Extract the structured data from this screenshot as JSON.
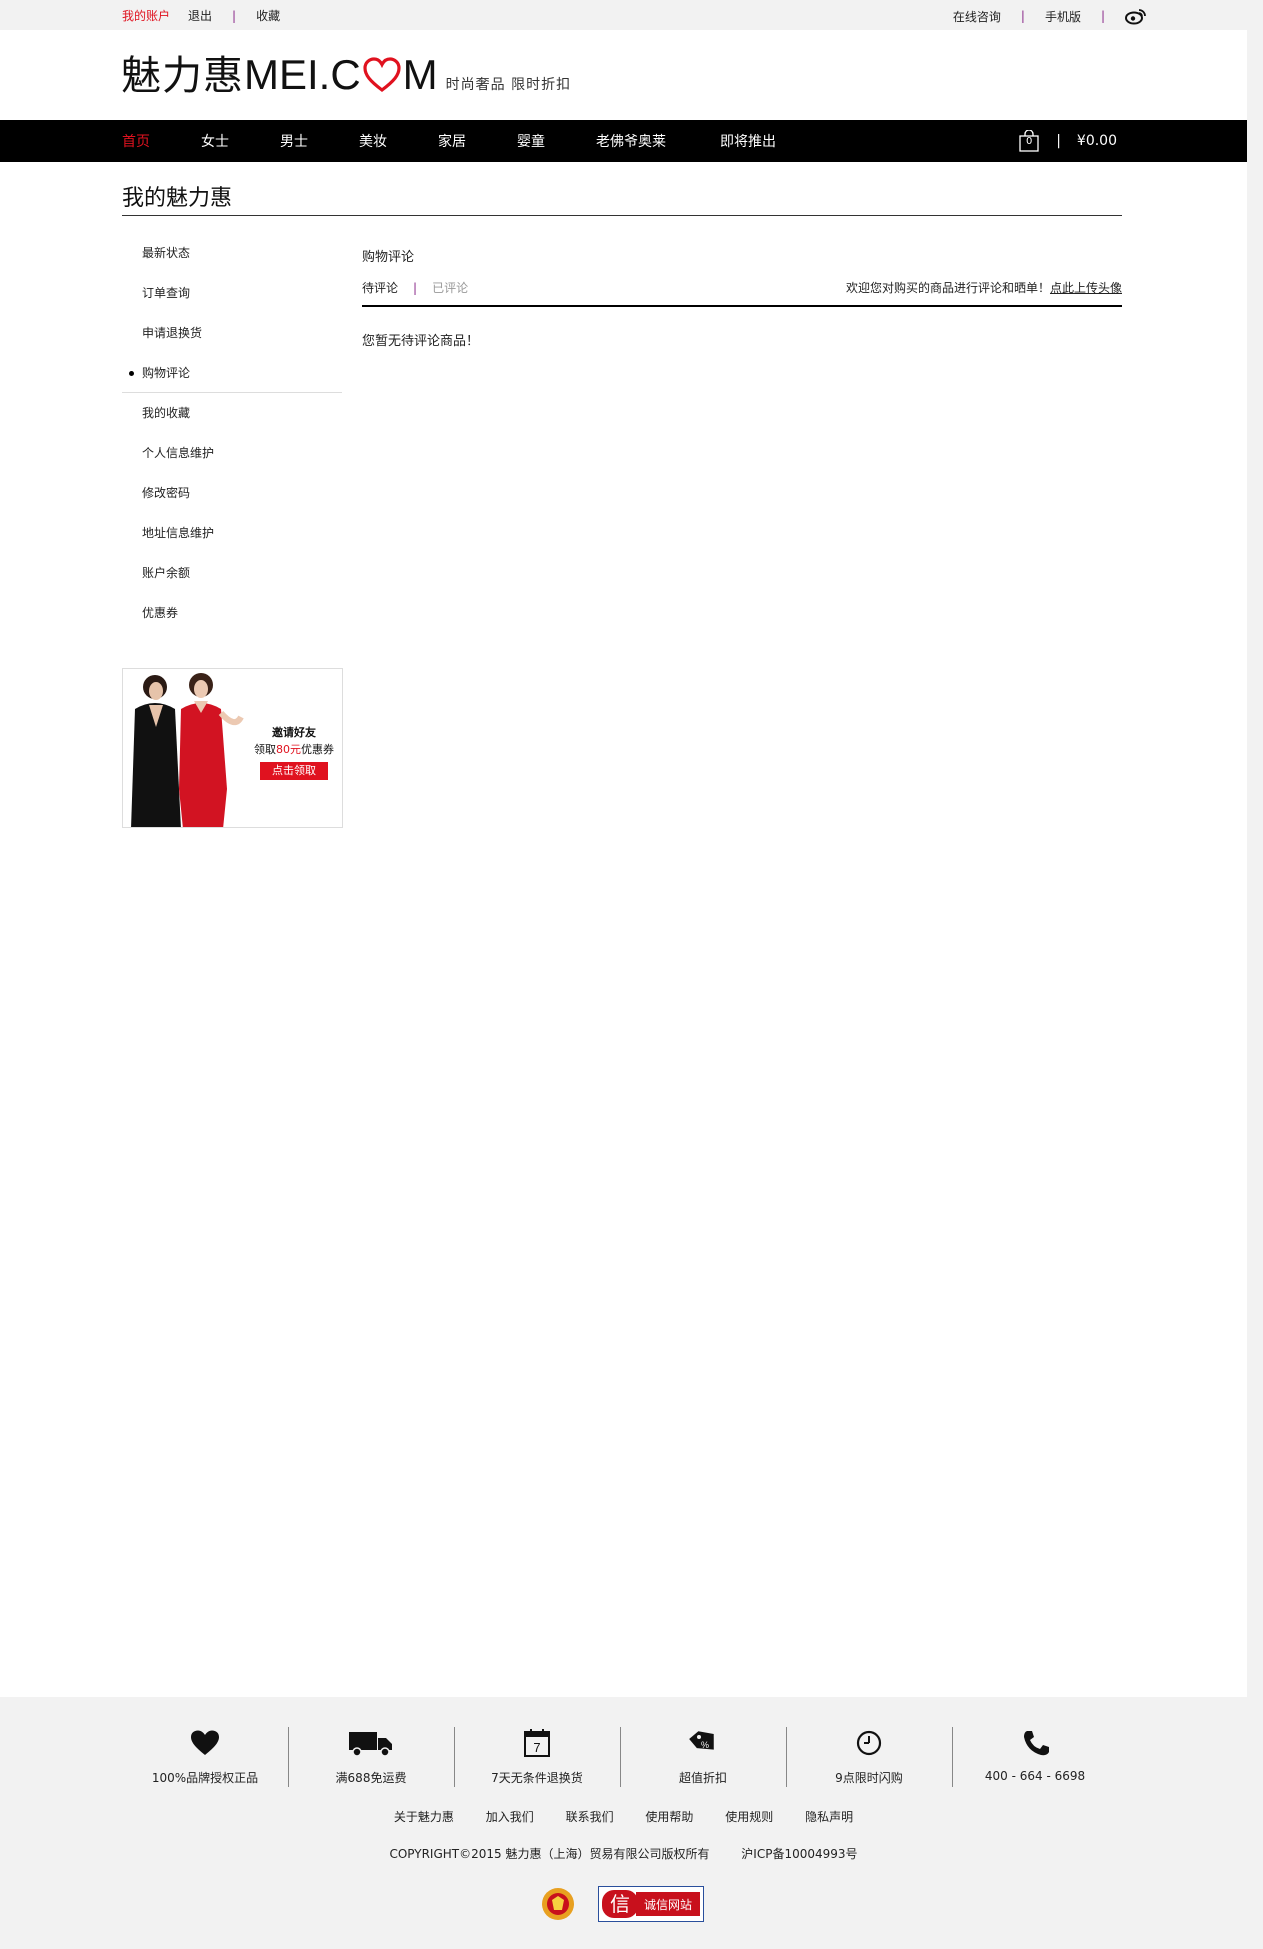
{
  "topbar": {
    "my_account": "我的账户",
    "logout": "退出",
    "favorites": "收藏",
    "online_consult": "在线咨询",
    "mobile": "手机版",
    "weibo_icon": "weibo-icon"
  },
  "header": {
    "logo_cn": "魅力惠",
    "logo_en_left": "MEI.C",
    "logo_en_right": "M",
    "tagline": "时尚奢品 限时折扣"
  },
  "nav": {
    "items": [
      "首页",
      "女士",
      "男士",
      "美妆",
      "家居",
      "婴童",
      "老佛爷奥莱",
      "即将推出"
    ],
    "cart_count": "0",
    "cart_total": "¥0.00",
    "pipe": "|"
  },
  "page": {
    "title": "我的魅力惠"
  },
  "sidebar": {
    "items": [
      "最新状态",
      "订单查询",
      "申请退换货",
      "购物评论",
      "我的收藏",
      "个人信息维护",
      "修改密码",
      "地址信息维护",
      "账户余额",
      "优惠券"
    ]
  },
  "promo": {
    "line1": "邀请好友",
    "line2_pre": "领取",
    "line2_amount": "80元",
    "line2_post": "优惠券",
    "button": "点击领取"
  },
  "main": {
    "title": "购物评论",
    "tab_pending": "待评论",
    "tab_sep": "|",
    "tab_done": "已评论",
    "hint_text": "欢迎您对购买的商品进行评论和晒单！",
    "hint_link": "点此上传头像",
    "empty_message": "您暂无待评论商品！"
  },
  "footer": {
    "features": [
      {
        "icon": "heart-icon",
        "label": "100%品牌授权正品"
      },
      {
        "icon": "truck-icon",
        "label": "满688免运费"
      },
      {
        "icon": "calendar-icon",
        "label": "7天无条件退换货",
        "icon_text": "7"
      },
      {
        "icon": "price-tag-icon",
        "label": "超值折扣"
      },
      {
        "icon": "clock-icon",
        "label": "9点限时闪购"
      },
      {
        "icon": "phone-icon",
        "label": "400 - 664 - 6698"
      }
    ],
    "links": [
      "关于魅力惠",
      "加入我们",
      "联系我们",
      "使用帮助",
      "使用规则",
      "隐私声明"
    ],
    "copyright": "COPYRIGHT©2015 魅力惠（上海）贸易有限公司版权所有",
    "icp": "沪ICP备10004993号",
    "badge_cx_char": "信",
    "badge_cx_text": "诚信网站"
  },
  "colors": {
    "accent_red": "#e0121f",
    "nav_bg": "#000000",
    "separator_purple": "#8a2a8a"
  }
}
